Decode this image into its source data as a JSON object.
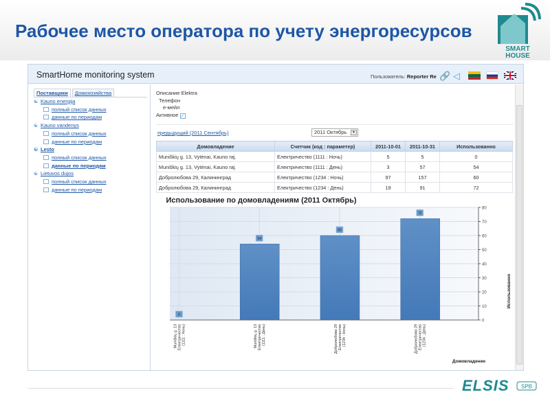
{
  "slide_title": "Рабочее место оператора по учету энергоресурсов",
  "logo": {
    "text": "SMART HOUSE",
    "colors": {
      "teal": "#1e8a8f",
      "light": "#7ec8cc"
    }
  },
  "footer_logo": {
    "text": "ELSIS",
    "suffix": "SPB"
  },
  "app": {
    "title": "SmartHome monitoring system",
    "user_label": "Пользователь:",
    "user_name": "Reporter Re",
    "icons": [
      "link-icon",
      "share-icon"
    ],
    "flags": [
      "lithuania-flag",
      "russia-flag",
      "uk-flag"
    ]
  },
  "tabs": [
    {
      "label": "Поставщики",
      "active": true
    },
    {
      "label": "Домохозяйства",
      "active": false
    }
  ],
  "providers": [
    {
      "name": "Kauno energija",
      "items": [
        "полный список данных",
        "данные по периодам"
      ]
    },
    {
      "name": "Kauno vandenys",
      "items": [
        "полный список данных",
        "данные по периодам"
      ]
    },
    {
      "name": "Lesto",
      "selected": true,
      "items": [
        "полный список данных",
        "данные по периодам"
      ],
      "selected_item": 1
    },
    {
      "name": "Lietuvos dujos",
      "items": [
        "полный список данных",
        "данные по периодам"
      ]
    }
  ],
  "info": {
    "description": "Описание Elektra",
    "phone": "Телефон",
    "email": "е-мейл",
    "active": "Активное",
    "active_checked": true
  },
  "nav": {
    "prev": "предыдущий (2011 Сентябрь)",
    "period": "2011 Октябрь"
  },
  "table": {
    "headers": [
      "Домовладение",
      "Счетчик (код : параметер)",
      "2011-10-01",
      "2011-10-31",
      "Использованно"
    ],
    "rows": [
      [
        "Muniškių g. 13, Vytėnai, Kauno raj.",
        "Електричество (1111 : Ночь)",
        "5",
        "5",
        "0"
      ],
      [
        "Muniškių g. 13, Vytėnai, Kauno raj.",
        "Електричество (1111 : День)",
        "3",
        "57",
        "54"
      ],
      [
        "Добролюбова 29, Калининград",
        "Електричество (1234 : Ночь)",
        "97",
        "157",
        "60"
      ],
      [
        "Добролюбова 29, Калининград",
        "Електричество (1234 : День)",
        "19",
        "91",
        "72"
      ]
    ]
  },
  "chart_data": {
    "type": "bar",
    "title": "Использование по домовладениям (2011 Октябрь)",
    "xlabel": "Домовладение",
    "ylabel": "Использованно",
    "categories": [
      [
        "Muniškių g. 13",
        "Електричество",
        "(1111 : Ночь)"
      ],
      [
        "Muniškių g. 13",
        "Електричество",
        "(1111 : День)"
      ],
      [
        "Добролюбова 29",
        "Електричество",
        "(1234 : Ночь)"
      ],
      [
        "Добролюбова 29",
        "Електричество",
        "(1234 : День)"
      ]
    ],
    "values": [
      0,
      54,
      60,
      72
    ],
    "ylim": [
      0,
      80
    ],
    "yticks": [
      0,
      10,
      20,
      30,
      40,
      50,
      60,
      70,
      80
    ],
    "grid": true,
    "y_axis_position": "right",
    "bar_color": "#4479b8"
  }
}
